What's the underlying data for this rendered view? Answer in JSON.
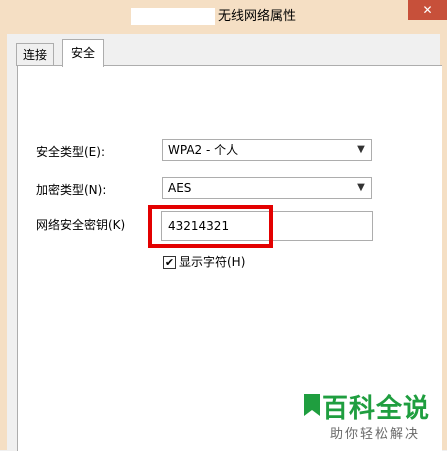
{
  "window": {
    "title": "无线网络属性",
    "close_glyph": "✕"
  },
  "tabs": [
    {
      "label": "连接"
    },
    {
      "label": "安全"
    }
  ],
  "security": {
    "type_label": "安全类型(E):",
    "type_value": "WPA2 - 个人",
    "encryption_label": "加密类型(N):",
    "encryption_value": "AES",
    "key_label": "网络安全密钥(K)",
    "key_value": "43214321",
    "show_chars_label": "显示字符(H)",
    "show_chars_checked": true
  },
  "watermark": {
    "title": "百科全说",
    "subtitle": "助你轻松解决"
  },
  "colors": {
    "highlight": "#e30000",
    "titlebar": "#f5dfc4",
    "watermark": "#1f9e3f"
  }
}
